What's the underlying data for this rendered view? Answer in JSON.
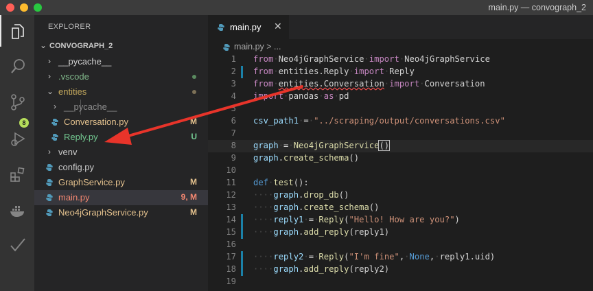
{
  "window": {
    "title": "main.py — convograph_2"
  },
  "activity_bar": {
    "items": [
      {
        "name": "explorer-icon"
      },
      {
        "name": "search-icon"
      },
      {
        "name": "source-control-icon",
        "badge": "8"
      },
      {
        "name": "debug-icon"
      },
      {
        "name": "extensions-icon"
      },
      {
        "name": "docker-icon"
      },
      {
        "name": "check-icon"
      }
    ]
  },
  "sidebar": {
    "title": "EXPLORER",
    "folder": {
      "label": "CONVOGRAPH_2"
    },
    "items": [
      {
        "label": "__pycache__",
        "kind": "folder-collapsed",
        "color": "#cccccc"
      },
      {
        "label": ".vscode",
        "kind": "folder-collapsed",
        "color": "#81b88b",
        "status_dot": "#5a8a5f"
      },
      {
        "label": "entities",
        "kind": "folder-open",
        "color": "#c4a95d",
        "status_dot": "#7d7157"
      },
      {
        "label": "__pycache__",
        "kind": "folder-collapsed",
        "color": "#8c8c8c"
      },
      {
        "label": "Conversation.py",
        "kind": "py",
        "color": "#e2c08d",
        "status": "M"
      },
      {
        "label": "Reply.py",
        "kind": "py",
        "color": "#73c991",
        "status": "U"
      },
      {
        "label": "venv",
        "kind": "folder-collapsed",
        "color": "#cccccc"
      },
      {
        "label": "config.py",
        "kind": "py",
        "color": "#cccccc"
      },
      {
        "label": "GraphService.py",
        "kind": "py",
        "color": "#e2c08d",
        "status": "M"
      },
      {
        "label": "main.py",
        "kind": "py",
        "color": "#f48771",
        "status": "9, M"
      },
      {
        "label": "Neo4jGraphService.py",
        "kind": "py",
        "color": "#e2c08d",
        "status": "M"
      }
    ]
  },
  "editor": {
    "tab": {
      "label": "main.py",
      "close": "✕"
    },
    "breadcrumb": "main.py > ...",
    "line_numbers": [
      "1",
      "2",
      "3",
      "4",
      "5",
      "6",
      "7",
      "8",
      "9",
      "10",
      "11",
      "12",
      "13",
      "14",
      "15",
      "16",
      "17",
      "18",
      "19"
    ],
    "lines": {
      "l1": [
        "from",
        "Neo4jGraphService",
        "import",
        "Neo4jGraphService"
      ],
      "l2": [
        "from",
        "entities.Reply",
        "import",
        "Reply"
      ],
      "l3": [
        "from",
        "entities.Conversation",
        "import",
        "Conversation"
      ],
      "l4": [
        "import",
        "pandas",
        "as",
        "pd"
      ],
      "l6": [
        "csv_path1",
        "=",
        "\"../scraping/output/conversations.csv\""
      ],
      "l8": [
        "graph",
        "=",
        "Neo4jGraphService",
        "()"
      ],
      "l9": [
        "graph",
        ".",
        "create_schema",
        "()"
      ],
      "l11": [
        "def",
        "test",
        "():"
      ],
      "l12": [
        "graph",
        ".",
        "drop_db",
        "()"
      ],
      "l13": [
        "graph",
        ".",
        "create_schema",
        "()"
      ],
      "l14": [
        "reply1",
        "=",
        "Reply",
        "(",
        "\"Hello! How are you?\"",
        ")"
      ],
      "l15": [
        "graph",
        ".",
        "add_reply",
        "(reply1)"
      ],
      "l17": [
        "reply2",
        "=",
        "Reply",
        "(",
        "\"I'm fine\"",
        ",",
        "None",
        ",",
        "reply1.uid)"
      ],
      "l18": [
        "graph",
        ".",
        "add_reply",
        "(reply2)"
      ]
    }
  },
  "annotation": {
    "arrow_color": "#e8342a"
  }
}
